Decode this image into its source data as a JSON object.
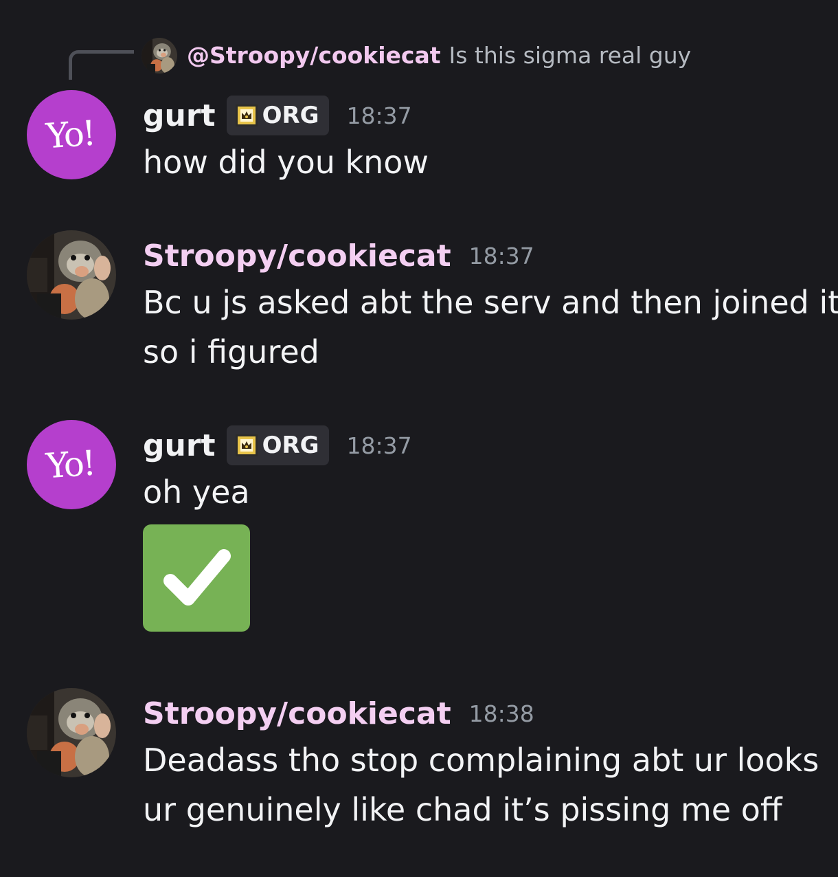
{
  "reply": {
    "mention": "@Stroopy/cookiecat",
    "text": "Is this sigma real guy"
  },
  "messages": [
    {
      "author": "gurt",
      "tag": "ORG",
      "time": "18:37",
      "lines": [
        "how did you know"
      ]
    },
    {
      "author": "Stroopy/cookiecat",
      "time": "18:37",
      "lines": [
        "Bc u js asked abt the serv and then joined it",
        "so i figured"
      ]
    },
    {
      "author": "gurt",
      "tag": "ORG",
      "time": "18:37",
      "lines": [
        "oh yea"
      ],
      "emoji": "check-mark-button"
    },
    {
      "author": "Stroopy/cookiecat",
      "time": "18:38",
      "lines": [
        "Deadass tho stop complaining abt ur looks",
        "ur genuinely like chad it’s pissing me off"
      ]
    }
  ],
  "avatar_logo": "Yo!",
  "colors": {
    "background": "#1a1a1e",
    "stroopy_name": "#f4cff2",
    "yo_avatar": "#b53fcd",
    "check_emoji": "#77b255",
    "timestamp": "#949ba4"
  }
}
